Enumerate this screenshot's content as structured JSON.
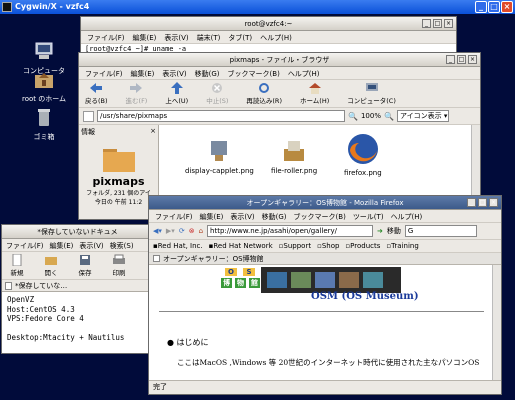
{
  "xp_window": {
    "title": "Cygwin/X - vzfc4"
  },
  "desktop_icons": [
    {
      "label": "コンピュータ",
      "icon": "computer-icon"
    },
    {
      "label": "root のホーム",
      "icon": "home-folder-icon"
    },
    {
      "label": "ゴミ箱",
      "icon": "trash-icon"
    }
  ],
  "terminal": {
    "title": "root@vzfc4:~",
    "menu": [
      "ファイル(F)",
      "編集(E)",
      "表示(V)",
      "端末(T)",
      "タブ(T)",
      "ヘルプ(H)"
    ],
    "prompt": "[root@vzfc4 ~]# uname -a"
  },
  "filebrowser": {
    "title": "pixmaps - ファイル・ブラウザ",
    "menu": [
      "ファイル(F)",
      "編集(E)",
      "表示(V)",
      "移動(G)",
      "ブックマーク(B)",
      "ヘルプ(H)"
    ],
    "toolbar": [
      {
        "label": "戻る(B)",
        "icon": "back-arrow-icon",
        "enabled": true
      },
      {
        "label": "進む(F)",
        "icon": "forward-arrow-icon",
        "enabled": false
      },
      {
        "label": "上へ(U)",
        "icon": "up-arrow-icon",
        "enabled": true
      },
      {
        "label": "中止(S)",
        "icon": "stop-icon",
        "enabled": false
      },
      {
        "label": "再読込み(R)",
        "icon": "reload-icon",
        "enabled": true
      },
      {
        "label": "ホーム(H)",
        "icon": "home-icon",
        "enabled": true
      },
      {
        "label": "コンピュータ(C)",
        "icon": "computer-icon",
        "enabled": true
      }
    ],
    "location": "/usr/share/pixmaps",
    "zoom": "100%",
    "view_mode": "アイコン表示",
    "side_pane": {
      "selector": "情報",
      "folder_name": "pixmaps",
      "folder_info1": "フォルダ, 231 個のアイ",
      "folder_info2": "今日の 午前 11:2"
    },
    "files": [
      {
        "name": "display-capplet.png",
        "icon": "display-capplet-icon"
      },
      {
        "name": "file-roller.png",
        "icon": "file-roller-icon"
      },
      {
        "name": "firefox.png",
        "icon": "firefox-icon"
      }
    ]
  },
  "gedit": {
    "title": "*保存していないドキュメ",
    "menu": [
      "ファイル(F)",
      "編集(E)",
      "表示(V)",
      "検索(S)"
    ],
    "toolbar": [
      {
        "label": "新規",
        "icon": "new-document-icon"
      },
      {
        "label": "開く",
        "icon": "open-folder-icon"
      },
      {
        "label": "保存",
        "icon": "save-icon"
      },
      {
        "label": "印刷",
        "icon": "print-icon"
      }
    ],
    "tab_label": "*保存していな…",
    "lines": [
      "OpenVZ",
      "Host:CentOS 4.3",
      "VPS:Fedore Core 4",
      "",
      "Desktop:Mtacity + Nautilus"
    ]
  },
  "firefox": {
    "title": "オープンギャラリー：OS博物館 - Mozilla Firefox",
    "menu": [
      "ファイル(F)",
      "編集(E)",
      "表示(V)",
      "移動(G)",
      "ブックマーク(B)",
      "ツール(T)",
      "ヘルプ(H)"
    ],
    "url": "http://www.ne.jp/asahi/open/gallery/",
    "go_label": "移動",
    "search_placeholder": "",
    "bookmarks": [
      "Red Hat, Inc.",
      "Red Hat Network",
      "Support",
      "Shop",
      "Products",
      "Training"
    ],
    "tab_title": "オープンギャラリー：OS博物館",
    "logo_chars": [
      "O",
      "S",
      "博",
      "物",
      "館"
    ],
    "logo_text": "OSM (OS Museum)",
    "bullet": "はじめに",
    "paragraph": "ここはMacOS ,Windows 等 20世紀のインターネット時代に使用された主なパソコンOS",
    "status": "完了"
  }
}
